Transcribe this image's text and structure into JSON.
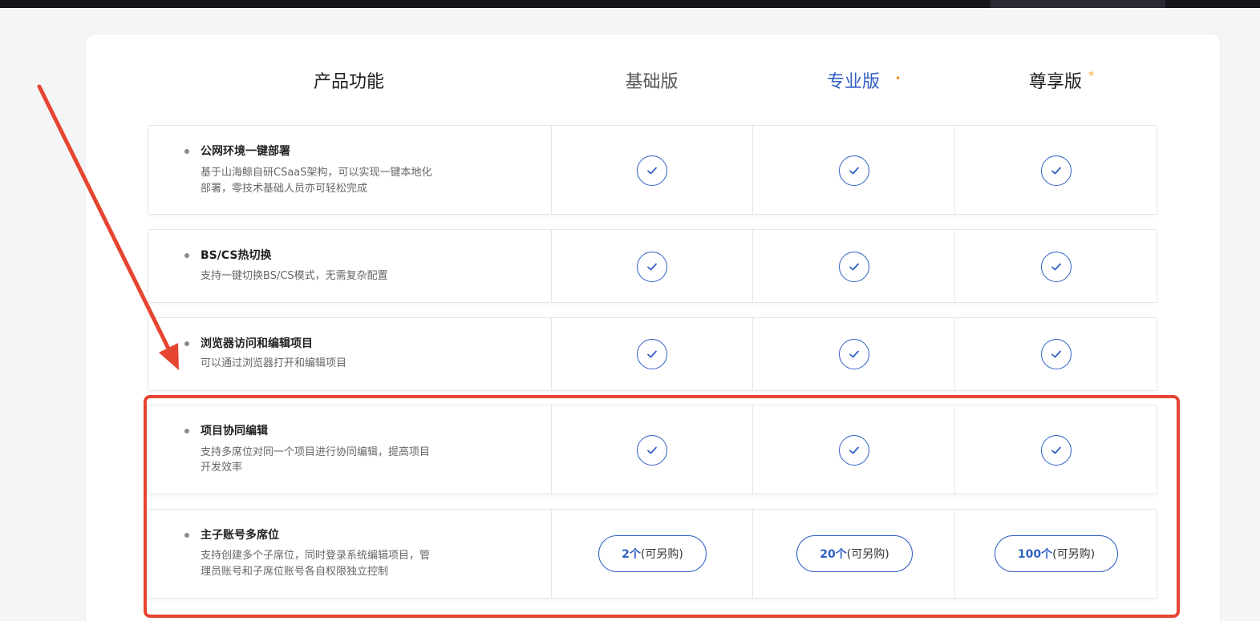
{
  "header": {
    "features": "产品功能",
    "basic": "基础版",
    "pro": "专业版",
    "premium": "尊享版",
    "pro_marker": "•",
    "premium_marker": "*"
  },
  "rows": [
    {
      "title": "公网环境一键部署",
      "desc_line1": "基于山海鲸自研CSaaS架构，可以实现一键本地化",
      "desc_line2": "部署，零技术基础人员亦可轻松完成"
    },
    {
      "title": "BS/CS热切换",
      "desc_line1": "支持一键切换BS/CS模式，无需复杂配置"
    },
    {
      "title": "浏览器访问和编辑项目",
      "desc_line1": "可以通过浏览器打开和编辑项目"
    },
    {
      "title": "项目协同编辑",
      "desc_line1": "支持多席位对同一个项目进行协同编辑，提高项目",
      "desc_line2": "开发效率"
    },
    {
      "title": "主子账号多席位",
      "desc_line1": "支持创建多个子席位，同时登录系统编辑项目，管",
      "desc_line2": "理员账号和子席位账号各自权限独立控制",
      "seats": [
        {
          "num": "2个",
          "suffix": "(可另购)"
        },
        {
          "num": "20个",
          "suffix": "(可另购)"
        },
        {
          "num": "100个",
          "suffix": "(可另购)"
        }
      ]
    }
  ],
  "icons": {
    "check": "check-circle-icon"
  },
  "colors": {
    "accent": "#2f5fc4",
    "annotation": "#e54531",
    "pro_dot": "#f58a1f",
    "premium_star": "#f5a623"
  }
}
